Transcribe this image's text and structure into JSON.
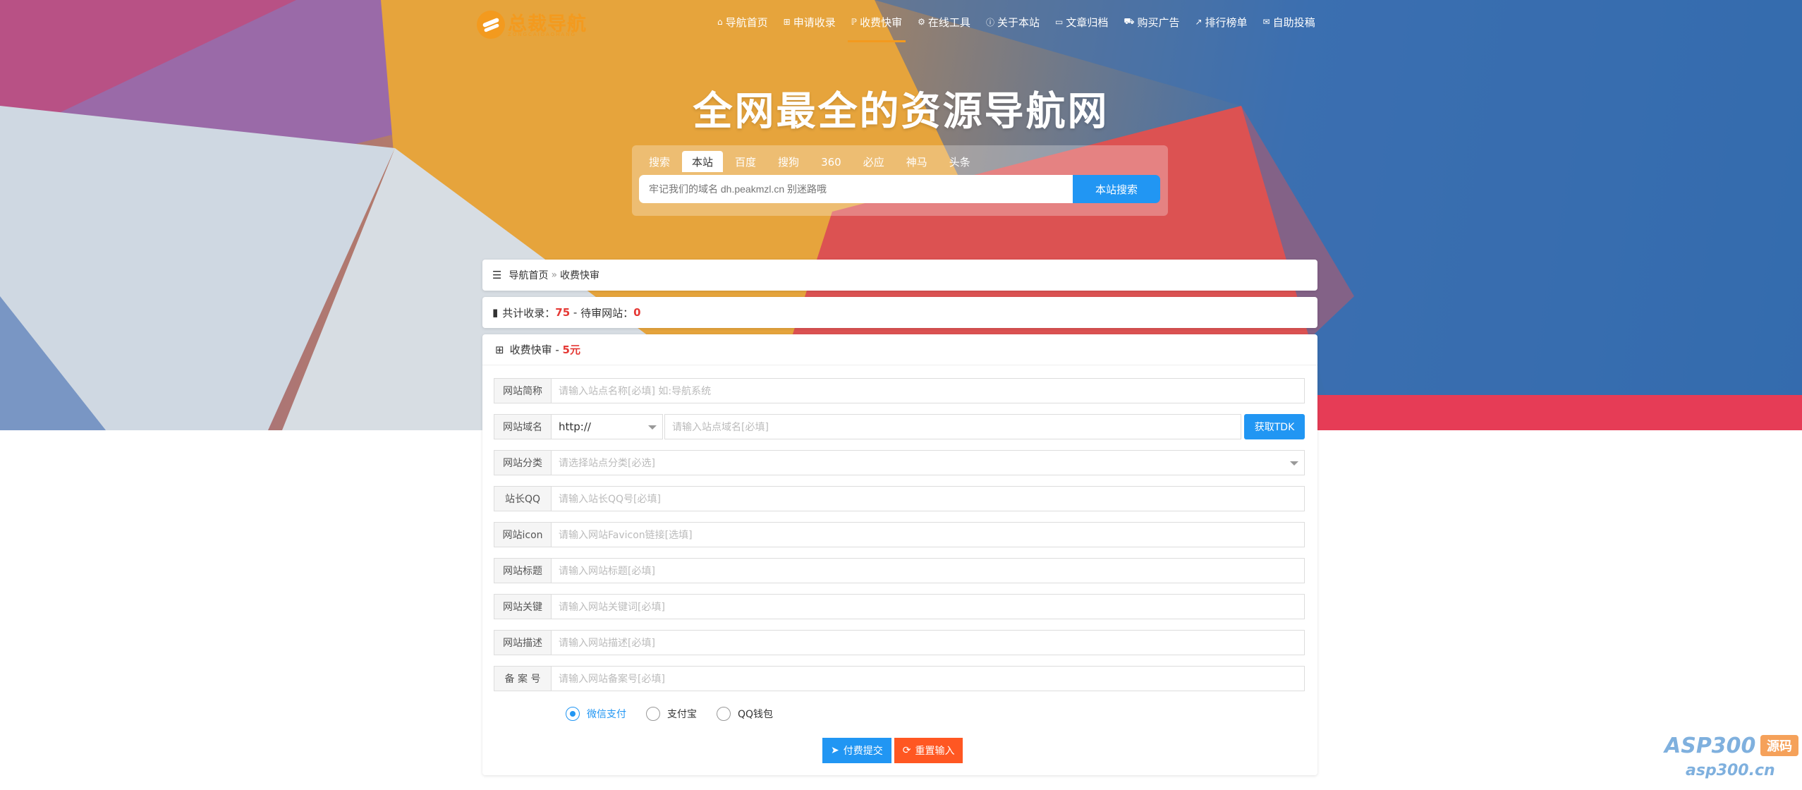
{
  "colors": {
    "accent": "#2196f3",
    "brand": "#f39a1e",
    "danger": "#e53935",
    "reset": "#ff5722"
  },
  "logo": {
    "title": "总裁导航",
    "subtitle": "ZONGCAIDAOHANG"
  },
  "nav": [
    {
      "label": "导航首页",
      "icon": "home-icon",
      "active": false
    },
    {
      "label": "申请收录",
      "icon": "plus-square-icon",
      "active": false
    },
    {
      "label": "收费快审",
      "icon": "paypal-icon",
      "active": true
    },
    {
      "label": "在线工具",
      "icon": "cogs-icon",
      "active": false
    },
    {
      "label": "关于本站",
      "icon": "info-circle-icon",
      "active": false
    },
    {
      "label": "文章归档",
      "icon": "folder-open-icon",
      "active": false
    },
    {
      "label": "购买广告",
      "icon": "shopping-cart-icon",
      "active": false
    },
    {
      "label": "排行榜单",
      "icon": "line-chart-icon",
      "active": false
    },
    {
      "label": "自助投稿",
      "icon": "envelope-open-icon",
      "active": false
    }
  ],
  "hero": {
    "title": "全网最全的资源导航网"
  },
  "search": {
    "tabs": [
      {
        "label": "搜索",
        "active": false
      },
      {
        "label": "本站",
        "active": true
      },
      {
        "label": "百度",
        "active": false
      },
      {
        "label": "搜狗",
        "active": false
      },
      {
        "label": "360",
        "active": false
      },
      {
        "label": "必应",
        "active": false
      },
      {
        "label": "神马",
        "active": false
      },
      {
        "label": "头条",
        "active": false
      }
    ],
    "placeholder": "牢记我们的域名 dh.peakmzl.cn 别迷路哦",
    "button": "本站搜索"
  },
  "breadcrumb": {
    "home": "导航首页",
    "separator": "»",
    "current": "收费快审"
  },
  "stats": {
    "total_label": "共计收录：",
    "total": "75",
    "sep": " - ",
    "pending_label": "待审网站：",
    "pending": "0"
  },
  "form": {
    "title": "收费快审 - ",
    "price": "5元",
    "fields": {
      "name": {
        "label": "网站简称",
        "placeholder": "请输入站点名称[必填] 如:导航系统"
      },
      "domain": {
        "label": "网站域名",
        "protocol": "http://",
        "placeholder": "请输入站点域名[必填]",
        "tdk_button": "获取TDK"
      },
      "category": {
        "label": "网站分类",
        "placeholder": "请选择站点分类[必选]"
      },
      "qq": {
        "label": "站长QQ",
        "placeholder": "请输入站长QQ号[必填]"
      },
      "icon": {
        "label": "网站icon",
        "placeholder": "请输入网站Favicon链接[选填]"
      },
      "title": {
        "label": "网站标题",
        "placeholder": "请输入网站标题[必填]"
      },
      "keywords": {
        "label": "网站关键",
        "placeholder": "请输入网站关键词[必填]"
      },
      "description": {
        "label": "网站描述",
        "placeholder": "请输入网站描述[必填]"
      },
      "icp": {
        "label": "备 案 号",
        "placeholder": "请输入网站备案号[必填]"
      }
    },
    "payment": {
      "options": [
        "微信支付",
        "支付宝",
        "QQ钱包"
      ],
      "selected": "微信支付"
    },
    "submit": "付费提交",
    "reset": "重置输入"
  },
  "watermark": {
    "brand": "ASP300",
    "badge": "源码",
    "url": "asp300.cn"
  }
}
